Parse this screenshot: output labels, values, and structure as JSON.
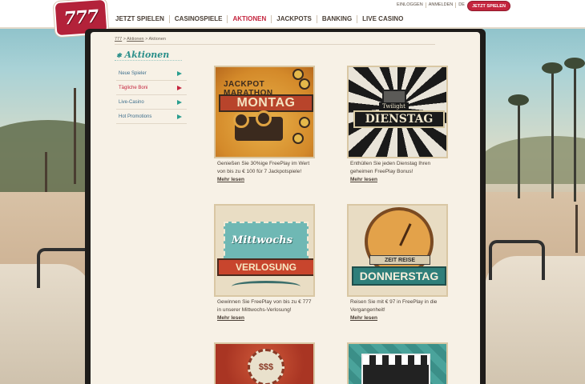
{
  "brand": {
    "logo_text": "777",
    "accent": "#c4253e",
    "teal": "#2a8f8a"
  },
  "toplinks": {
    "login": "EINLOGGEN",
    "register": "ANMELDEN",
    "lang": "DE"
  },
  "cta_label": "JETZT SPIELEN",
  "nav": [
    {
      "label": "JETZT SPIELEN"
    },
    {
      "label": "CASINOSPIELE"
    },
    {
      "label": "AKTIONEN"
    },
    {
      "label": "JACKPOTS"
    },
    {
      "label": "BANKING"
    },
    {
      "label": "LIVE CASINO"
    }
  ],
  "breadcrumb": {
    "home": "777",
    "section": "Aktionen",
    "current": "Aktionen"
  },
  "page_title": "Aktionen",
  "sidebar": [
    {
      "label": "Neue Spieler"
    },
    {
      "label": "Tägliche Boni"
    },
    {
      "label": "Live-Casino"
    },
    {
      "label": "Hot Promotions"
    }
  ],
  "promos": [
    {
      "art_top": "JACKPOT MARATHON",
      "art_banner": "MONTAG",
      "desc": "Genießen Sie 30%ige FreePlay im Wert von bis zu € 100 für 7 Jackpotspiele!",
      "more": "Mehr lesen"
    },
    {
      "art_top": "Twilight",
      "art_banner": "DIENSTAG",
      "desc": "Enthüllen Sie jeden Dienstag Ihren geheimen FreePlay Bonus!",
      "more": "Mehr lesen"
    },
    {
      "art_top": "Mittwochs",
      "art_banner": "VERLOSUNG",
      "desc": "Gewinnen Sie FreePlay von bis zu € 777 in unserer Mittwochs-Verlosung!",
      "more": "Mehr lesen"
    },
    {
      "art_top": "ZEIT REISE",
      "art_banner": "DONNERSTAG",
      "desc": "Reisen Sie mit € 97 in FreePlay in die Vergangenheit!",
      "more": "Mehr lesen"
    },
    {
      "art_top": "$$$"
    },
    {
      "art_top": ""
    }
  ]
}
